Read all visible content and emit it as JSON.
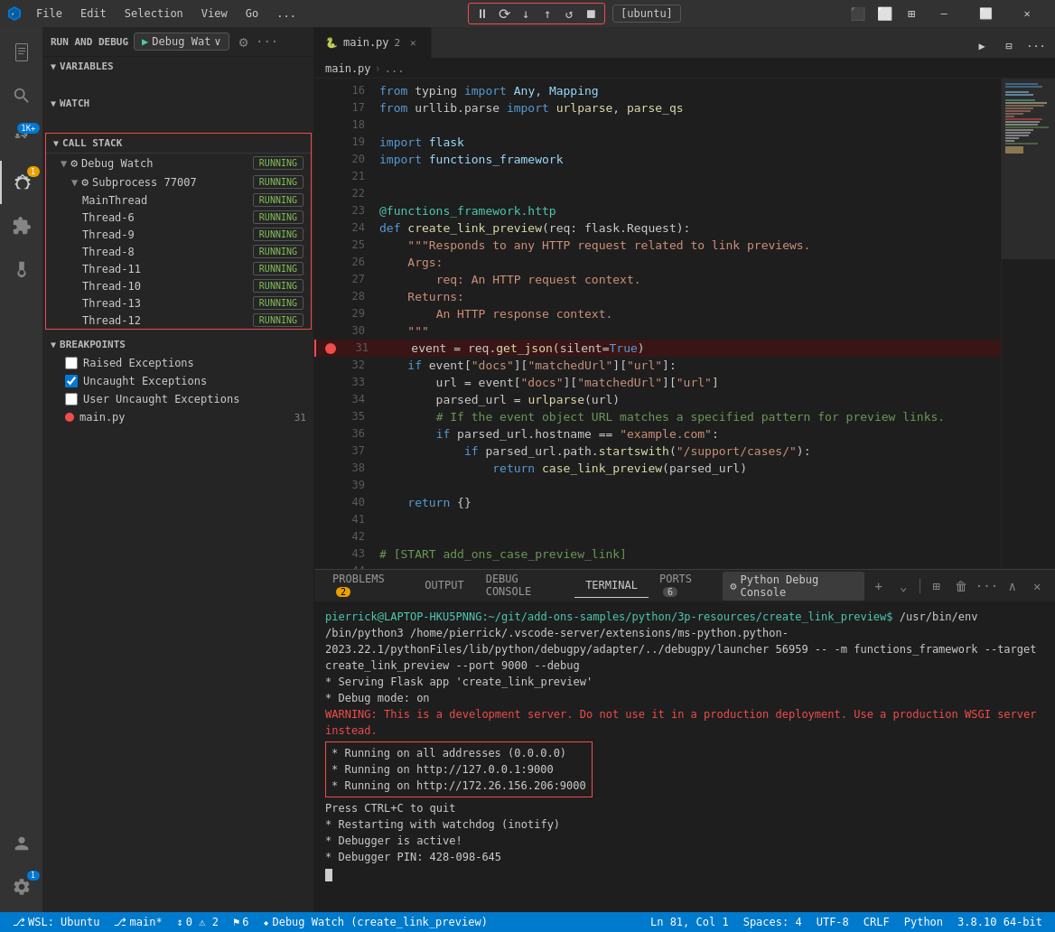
{
  "titlebar": {
    "app_icon": "VS",
    "menus": [
      "File",
      "Edit",
      "Selection",
      "View",
      "Go",
      "..."
    ],
    "debug_controls": {
      "pause": "⏸",
      "step_over": "↷",
      "step_into": "↓",
      "step_out": "↑",
      "restart": "↺",
      "stop": "⏹"
    },
    "debug_target": "[ubuntu]",
    "window_controls": [
      "—",
      "⬜",
      "✕"
    ]
  },
  "sidebar": {
    "run_debug_title": "RUN AND DEBUG",
    "debug_config": "Debug Wat",
    "sections": {
      "variables": "VARIABLES",
      "watch": "WATCH",
      "call_stack": "CALL STACK",
      "breakpoints": "BREAKPOINTS"
    }
  },
  "call_stack": {
    "groups": [
      {
        "name": "Debug Watch",
        "status": "RUNNING",
        "subgroups": [
          {
            "name": "Subprocess 77007",
            "status": "RUNNING",
            "threads": [
              {
                "name": "MainThread",
                "status": "RUNNING"
              },
              {
                "name": "Thread-6",
                "status": "RUNNING"
              },
              {
                "name": "Thread-9",
                "status": "RUNNING"
              },
              {
                "name": "Thread-8",
                "status": "RUNNING"
              },
              {
                "name": "Thread-11",
                "status": "RUNNING"
              },
              {
                "name": "Thread-10",
                "status": "RUNNING"
              },
              {
                "name": "Thread-13",
                "status": "RUNNING"
              },
              {
                "name": "Thread-12",
                "status": "RUNNING"
              }
            ]
          }
        ]
      }
    ]
  },
  "breakpoints": {
    "title": "BREAKPOINTS",
    "items": [
      {
        "label": "Raised Exceptions",
        "checked": false,
        "type": "checkbox"
      },
      {
        "label": "Uncaught Exceptions",
        "checked": true,
        "type": "checkbox"
      },
      {
        "label": "User Uncaught Exceptions",
        "checked": false,
        "type": "checkbox"
      },
      {
        "label": "main.py",
        "type": "dot",
        "line": 31
      }
    ]
  },
  "editor": {
    "tab_filename": "main.py",
    "tab_modified": true,
    "breadcrumb": [
      "main.py",
      "..."
    ],
    "lines": [
      {
        "num": 16,
        "content": "from typing import Any, Mapping"
      },
      {
        "num": 17,
        "content": "from urllib.parse import urlparse, parse_qs"
      },
      {
        "num": 18,
        "content": ""
      },
      {
        "num": 19,
        "content": "import flask"
      },
      {
        "num": 20,
        "content": "import functions_framework"
      },
      {
        "num": 21,
        "content": ""
      },
      {
        "num": 22,
        "content": ""
      },
      {
        "num": 23,
        "content": "@functions_framework.http"
      },
      {
        "num": 24,
        "content": "def create_link_preview(req: flask.Request):"
      },
      {
        "num": 25,
        "content": "    \"\"\"Responds to any HTTP request related to link previews."
      },
      {
        "num": 26,
        "content": "    Args:"
      },
      {
        "num": 27,
        "content": "        req: An HTTP request context."
      },
      {
        "num": 28,
        "content": "    Returns:"
      },
      {
        "num": 29,
        "content": "        An HTTP response context."
      },
      {
        "num": 30,
        "content": "    \"\"\""
      },
      {
        "num": 31,
        "content": "    event = req.get_json(silent=True)",
        "breakpoint": true
      },
      {
        "num": 32,
        "content": "    if event[\"docs\"][\"matchedUrl\"][\"url\"]:"
      },
      {
        "num": 33,
        "content": "        url = event[\"docs\"][\"matchedUrl\"][\"url\"]"
      },
      {
        "num": 34,
        "content": "        parsed_url = urlparse(url)"
      },
      {
        "num": 35,
        "content": "        # If the event object URL matches a specified pattern for preview links."
      },
      {
        "num": 36,
        "content": "        if parsed_url.hostname == \"example.com\":"
      },
      {
        "num": 37,
        "content": "            if parsed_url.path.startswith(\"/support/cases/\"):"
      },
      {
        "num": 38,
        "content": "                return case_link_preview(parsed_url)"
      },
      {
        "num": 39,
        "content": ""
      },
      {
        "num": 40,
        "content": "    return {}"
      },
      {
        "num": 41,
        "content": ""
      },
      {
        "num": 42,
        "content": ""
      },
      {
        "num": 43,
        "content": "# [START add_ons_case_preview_link]"
      },
      {
        "num": 44,
        "content": ""
      }
    ]
  },
  "terminal": {
    "tabs": [
      {
        "label": "PROBLEMS",
        "badge": "2",
        "badge_type": "orange"
      },
      {
        "label": "OUTPUT",
        "badge": null
      },
      {
        "label": "DEBUG CONSOLE",
        "badge": null
      },
      {
        "label": "TERMINAL",
        "badge": null,
        "active": true
      },
      {
        "label": "PORTS",
        "badge": "6"
      }
    ],
    "debug_console_label": "Python Debug Console",
    "terminal_lines": [
      {
        "color": "green",
        "text": "pierrick@LAPTOP-HKU5PNNG:~/git/add-ons-samples/python/3p-resources/create_link_preview$ /usr/bin/env /bin/python3 /home/pierrick/.vscode-server/extensions/ms-python.python-2023.22.1/pythonFiles/lib/python/debugpy/adapter/../debugpy/launcher 56959 -- -m functions_framework --target create_link_preview --port 9000 --debug"
      },
      {
        "color": "white",
        "text": " * Serving Flask app 'create_link_preview'"
      },
      {
        "color": "white",
        "text": " * Debug mode: on"
      },
      {
        "color": "red",
        "text": "WARNING: This is a development server. Do not use it in a production deployment. Use a production WSGI server instead."
      },
      {
        "color": "white",
        "text": " * Running on all addresses (0.0.0.0)",
        "highlighted": true
      },
      {
        "color": "white",
        "text": " * Running on http://127.0.0.1:9000",
        "highlighted": true
      },
      {
        "color": "white",
        "text": " * Running on http://172.26.156.206:9000",
        "highlighted": true
      },
      {
        "color": "white",
        "text": "Press CTRL+C to quit"
      },
      {
        "color": "white",
        "text": " * Restarting with watchdog (inotify)"
      },
      {
        "color": "white",
        "text": " * Debugger is active!"
      },
      {
        "color": "white",
        "text": " * Debugger PIN: 428-098-645"
      }
    ]
  },
  "statusbar": {
    "left_items": [
      {
        "label": "⎇ WSL: Ubuntu",
        "icon": "wsl-icon"
      },
      {
        "label": "⎇ main*",
        "icon": "branch-icon"
      },
      {
        "label": "↕ 0 ⚠ 2",
        "icon": "error-icon"
      },
      {
        "label": "⚑ 6",
        "icon": "port-icon"
      },
      {
        "label": "⬥ Debug Watch (create_link_preview)",
        "icon": "debug-icon"
      }
    ],
    "right_items": [
      {
        "label": "Ln 81, Col 1"
      },
      {
        "label": "Spaces: 4"
      },
      {
        "label": "UTF-8"
      },
      {
        "label": "CRLF"
      },
      {
        "label": "Python"
      },
      {
        "label": "3.8.10 64-bit"
      }
    ]
  }
}
